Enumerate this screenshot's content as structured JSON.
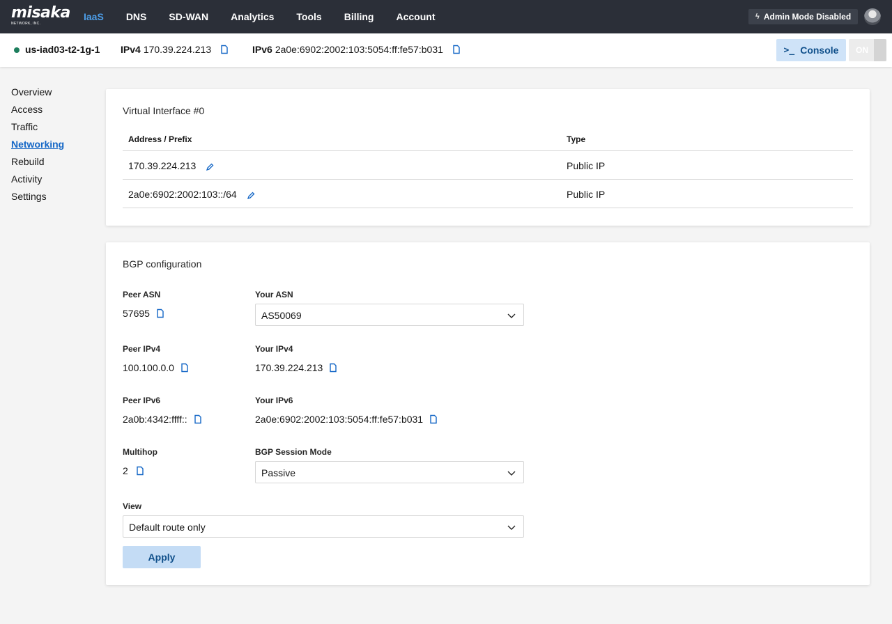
{
  "brand": {
    "name": "misaka",
    "sub": "NETWORK, INC."
  },
  "nav": {
    "items": [
      {
        "label": "IaaS",
        "active": true
      },
      {
        "label": "DNS"
      },
      {
        "label": "SD-WAN"
      },
      {
        "label": "Analytics"
      },
      {
        "label": "Tools"
      },
      {
        "label": "Billing"
      },
      {
        "label": "Account"
      }
    ],
    "admin_mode": "Admin Mode Disabled"
  },
  "instance": {
    "name": "us-iad03-t2-1g-1",
    "status_color": "#1d7e5d",
    "ipv4_label": "IPv4",
    "ipv4": "170.39.224.213",
    "ipv6_label": "IPv6",
    "ipv6": "2a0e:6902:2002:103:5054:ff:fe57:b031",
    "console_label": "Console",
    "power_label": "ON"
  },
  "sidebar": {
    "items": [
      {
        "label": "Overview"
      },
      {
        "label": "Access"
      },
      {
        "label": "Traffic"
      },
      {
        "label": "Networking",
        "active": true
      },
      {
        "label": "Rebuild"
      },
      {
        "label": "Activity"
      },
      {
        "label": "Settings"
      }
    ]
  },
  "virtual_interface": {
    "title": "Virtual Interface #0",
    "columns": [
      "Address / Prefix",
      "Type"
    ],
    "rows": [
      {
        "address": "170.39.224.213",
        "type": "Public IP"
      },
      {
        "address": "2a0e:6902:2002:103::/64",
        "type": "Public IP"
      }
    ]
  },
  "bgp": {
    "title": "BGP configuration",
    "peer_asn_label": "Peer ASN",
    "peer_asn": "57695",
    "your_asn_label": "Your ASN",
    "your_asn": "AS50069",
    "peer_ipv4_label": "Peer IPv4",
    "peer_ipv4": "100.100.0.0",
    "your_ipv4_label": "Your IPv4",
    "your_ipv4": "170.39.224.213",
    "peer_ipv6_label": "Peer IPv6",
    "peer_ipv6": "2a0b:4342:ffff::",
    "your_ipv6_label": "Your IPv6",
    "your_ipv6": "2a0e:6902:2002:103:5054:ff:fe57:b031",
    "multihop_label": "Multihop",
    "multihop": "2",
    "session_mode_label": "BGP Session Mode",
    "session_mode": "Passive",
    "view_label": "View",
    "view": "Default route only",
    "apply_label": "Apply"
  },
  "colors": {
    "accent": "#1366c6",
    "nav_bg": "#2b2f38",
    "nav_active": "#4d9fea",
    "button_bg": "#c4dcf5"
  }
}
